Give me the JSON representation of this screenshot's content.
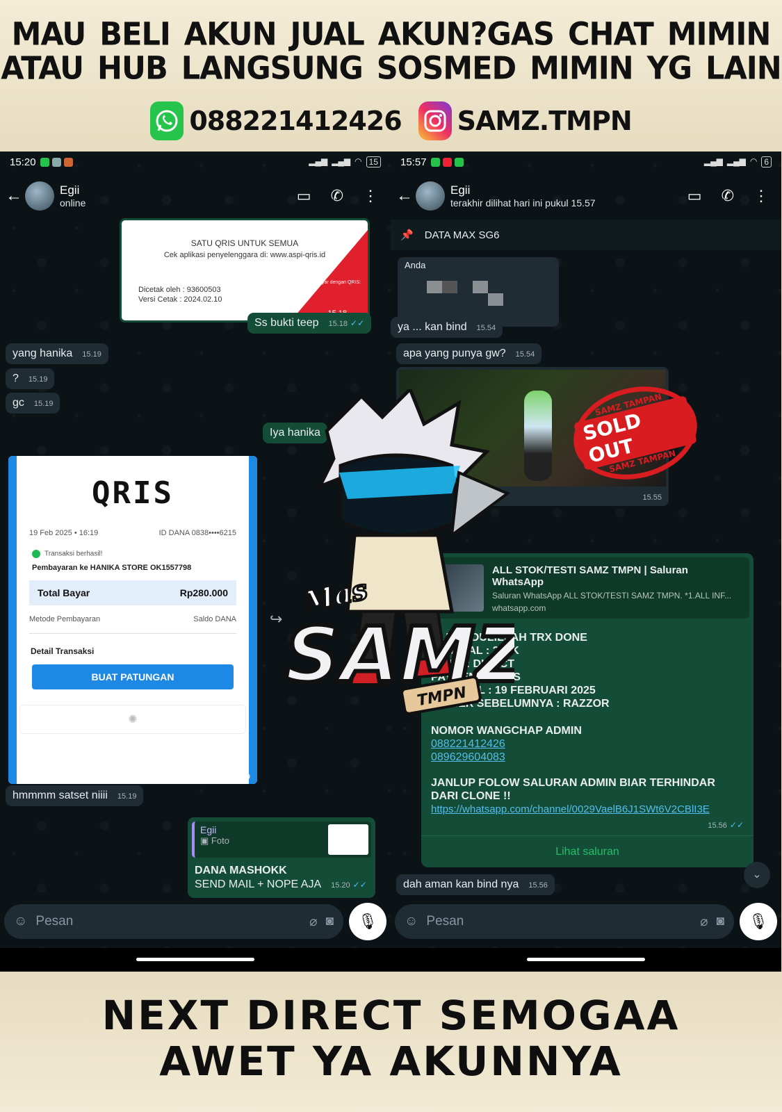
{
  "banner": {
    "line1": "MAU BELI AKUN JUAL AKUN?GAS CHAT MIMIN",
    "line2": "ATAU HUB LANGSUNG SOSMED MIMIN YG LAIN",
    "whatsapp_number": "088221412426",
    "instagram_handle": "SAMZ.TMPN",
    "bottom_line1": "NEXT DIRECT SEMOGAA",
    "bottom_line2": "AWET YA AKUNNYA"
  },
  "left": {
    "status_time": "15:20",
    "battery": "15",
    "contact_name": "Egii",
    "contact_status": "online",
    "qris_card": {
      "title": "SATU QRIS UNTUK SEMUA",
      "subtitle": "Cek aplikasi penyelenggara di: www.aspi-qris.id",
      "printed_by": "Dicetak oleh : 93600503",
      "version": "Versi Cetak : 2024.02.10",
      "pay_with": "Cara bayar dengan QRIS:",
      "time": "15.18"
    },
    "messages": [
      {
        "text": "Ss bukti teep",
        "time": "15.18"
      },
      {
        "text": "yang hanika",
        "time": "15.19"
      },
      {
        "text": "?",
        "time": "15.19"
      },
      {
        "text": "gc",
        "time": "15.19"
      },
      {
        "text": "Iya hanika",
        "time": ""
      },
      {
        "text": "hmmmm satset niiii",
        "time": "15.19"
      }
    ],
    "receipt": {
      "logo": "QRIS",
      "date": "19 Feb 2025 • 16:19",
      "id": "ID DANA 0838••••6215",
      "status": "Transaksi berhasil!",
      "payee": "Pembayaran ke HANIKA STORE OK1557798",
      "total_label": "Total Bayar",
      "total_value": "Rp280.000",
      "method_label": "Metode Pembayaran",
      "method_value": "Saldo DANA",
      "detail_label": "Detail Transaksi",
      "button": "BUAT PATUNGAN",
      "time": "15.19"
    },
    "reply": {
      "quoted_name": "Egii",
      "quoted_type": "Foto",
      "line1": "DANA MASHOKK",
      "line2": "SEND MAIL + NOPE AJA",
      "time": "15.20"
    },
    "input_placeholder": "Pesan"
  },
  "right": {
    "status_time": "15:57",
    "battery": "6",
    "contact_name": "Egii",
    "contact_status": "terakhir dilihat hari ini pukul 15.57",
    "pinned": "DATA MAX SG6",
    "quoted_author": "Anda",
    "messages": [
      {
        "text": "ya ... kan bind",
        "time": "15.54"
      },
      {
        "text": "apa yang punya gw?",
        "time": "15.54"
      },
      {
        "text": "dah aman kan bind nya",
        "time": "15.56"
      }
    ],
    "game_image_time": "15.55",
    "stamp": {
      "top": "SAMZ TAMPAN",
      "main": "SOLD OUT",
      "bottom": "SAMZ TAMPAN"
    },
    "channel": {
      "title": "ALL STOK/TESTI SAMZ TMPN | Saluran WhatsApp",
      "desc": "Saluran WhatsApp ALL STOK/TESTI SAMZ TMPN. *1.ALL INF...",
      "domain": "whatsapp.com",
      "body": [
        "ALHAMDULILLAH TRX DONE",
        "NOMINAL : 280K",
        "JENIS : DIRECT",
        "PAYMENT : QRIS",
        "TANGGAL : 19 FEBRUARI 2025",
        "OWNER SEBELUMNYA : RAZZOR"
      ],
      "admin_label": "NOMOR WANGCHAP ADMIN",
      "numbers": [
        "088221412426",
        "089629604083"
      ],
      "follow": "JANLUP FOLOW SALURAN ADMIN BIAR TERHINDAR DARI CLONE !!",
      "link": "https://whatsapp.com/channel/0029VaelB6J1SWt6V2CBlI3E",
      "time": "15.56",
      "button": "Lihat saluran"
    },
    "input_placeholder": "Pesan"
  },
  "mascot": {
    "text1": "Mas",
    "text2": "SAMZ",
    "text3": "TMPN"
  }
}
